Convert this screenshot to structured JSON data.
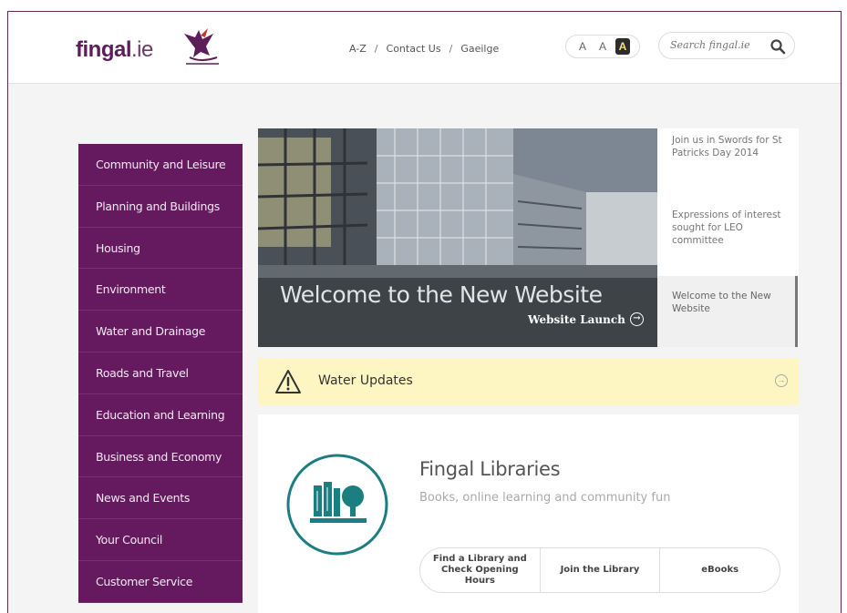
{
  "header": {
    "logo_main": "fingal",
    "logo_tld": ".ie",
    "links": [
      "A-Z",
      "Contact Us",
      "Gaeilge"
    ],
    "separator": "/",
    "font_size_options": [
      "A",
      "A",
      "A"
    ],
    "search_placeholder": "Search fingal.ie"
  },
  "sidebar": {
    "items": [
      {
        "label": "Community and Leisure"
      },
      {
        "label": "Planning and Buildings"
      },
      {
        "label": "Housing"
      },
      {
        "label": "Environment"
      },
      {
        "label": "Water and Drainage"
      },
      {
        "label": "Roads and Travel"
      },
      {
        "label": "Education and Learning"
      },
      {
        "label": "Business and Economy"
      },
      {
        "label": "News and Events"
      },
      {
        "label": "Your Council"
      },
      {
        "label": "Customer Service"
      }
    ]
  },
  "hero": {
    "title": "Welcome to the New Website",
    "link_label": "Website Launch"
  },
  "news": {
    "items": [
      {
        "label": "Join us in Swords for St Patricks Day 2014"
      },
      {
        "label": "Expressions of interest sought for LEO committee"
      },
      {
        "label": "Welcome to the New Website"
      }
    ]
  },
  "alert": {
    "label": "Water Updates"
  },
  "libraries": {
    "title": "Fingal Libraries",
    "subtitle": "Books, online learning and community fun",
    "buttons": [
      {
        "label": "Find a Library and Check Opening Hours"
      },
      {
        "label": "Join the Library"
      },
      {
        "label": "eBooks"
      }
    ]
  },
  "colors": {
    "brand_purple": "#651a5f",
    "alert_yellow": "#fdf6c3",
    "library_teal": "#1b7e80"
  }
}
